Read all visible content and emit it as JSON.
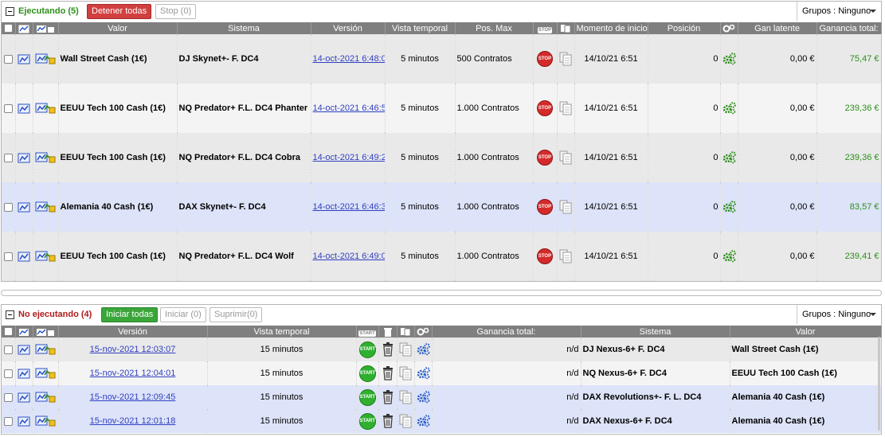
{
  "executing": {
    "title": "Ejecutando (5)",
    "stop_all_label": "Detener todas",
    "stop_label": "Stop (0)",
    "groups_label": "Grupos : Ninguno",
    "columns": {
      "valor": "Valor",
      "sistema": "Sistema",
      "version": "Versión",
      "vista": "Vista temporal",
      "posmax": "Pos. Max",
      "stop": "STOP",
      "inicio": "Momento de inicio",
      "posicion": "Posición",
      "latente": "Gan latente",
      "ganancia": "Ganancia total:"
    },
    "rows": [
      {
        "valor": "Wall Street Cash (1€)",
        "sistema": "DJ Skynet+-  F. DC4",
        "version": "14-oct-2021 6:48:0",
        "vista": "5 minutos",
        "posmax": "500 Contratos",
        "stop": "STOP",
        "inicio": "14/10/21 6:51",
        "posicion": "0",
        "latente": "0,00 €",
        "ganancia": "75,47 €",
        "style": "row-gray"
      },
      {
        "valor": "EEUU Tech 100 Cash (1€)",
        "sistema": "NQ Predator+ F.L. DC4 Phanter",
        "version": "14-oct-2021 6:46:5",
        "vista": "5 minutos",
        "posmax": "1.000 Contratos",
        "stop": "STOP",
        "inicio": "14/10/21 6:51",
        "posicion": "0",
        "latente": "0,00 €",
        "ganancia": "239,36 €",
        "style": "row-white"
      },
      {
        "valor": "EEUU Tech 100 Cash (1€)",
        "sistema": "NQ Predator+ F.L. DC4 Cobra",
        "version": "14-oct-2021 6:49:2",
        "vista": "5 minutos",
        "posmax": "1.000 Contratos",
        "stop": "STOP",
        "inicio": "14/10/21 6:51",
        "posicion": "0",
        "latente": "0,00 €",
        "ganancia": "239,36 €",
        "style": "row-gray"
      },
      {
        "valor": "Alemania 40 Cash (1€)",
        "sistema": "DAX Skynet+-  F. DC4",
        "version": "14-oct-2021 6:46:3",
        "vista": "5 minutos",
        "posmax": "1.000 Contratos",
        "stop": "STOP",
        "inicio": "14/10/21 6:51",
        "posicion": "0",
        "latente": "0,00 €",
        "ganancia": "83,57 €",
        "style": "row-blue"
      },
      {
        "valor": "EEUU Tech 100 Cash (1€)",
        "sistema": "NQ Predator+ F.L. DC4 Wolf",
        "version": "14-oct-2021 6:49:0",
        "vista": "5 minutos",
        "posmax": "1.000 Contratos",
        "stop": "STOP",
        "inicio": "14/10/21 6:51",
        "posicion": "0",
        "latente": "0,00 €",
        "ganancia": "239,41 €",
        "style": "row-gray"
      }
    ]
  },
  "not_executing": {
    "title": "No ejecutando (4)",
    "start_all_label": "Iniciar todas",
    "start_label": "Iniciar (0)",
    "delete_label": "Suprimir(0)",
    "groups_label": "Grupos : Ninguno",
    "columns": {
      "version": "Versión",
      "vista": "Vista temporal",
      "start": "START",
      "ganancia": "Ganancia total:",
      "sistema": "Sistema",
      "valor": "Valor"
    },
    "rows": [
      {
        "version": "15-nov-2021 12:03:07",
        "vista": "15 minutos",
        "start": "START",
        "ganancia": "n/d",
        "sistema": "DJ Nexus-6+ F. DC4",
        "valor": "Wall Street Cash (1€)",
        "style": "row-gray"
      },
      {
        "version": "15-nov-2021 12:04:01",
        "vista": "15 minutos",
        "start": "START",
        "ganancia": "n/d",
        "sistema": "NQ Nexus-6+ F. DC4",
        "valor": "EEUU Tech 100 Cash (1€)",
        "style": "row-white"
      },
      {
        "version": "15-nov-2021 12:09:45",
        "vista": "15 minutos",
        "start": "START",
        "ganancia": "n/d",
        "sistema": "DAX Revolutions+- F. L. DC4",
        "valor": "Alemania 40 Cash (1€)",
        "style": "row-blue"
      },
      {
        "version": "15-nov-2021 12:01:18",
        "vista": "15 minutos",
        "start": "START",
        "ganancia": "n/d",
        "sistema": "DAX Nexus-6+ F. DC4",
        "valor": "Alemania 40 Cash (1€)",
        "style": "row-blue"
      }
    ]
  }
}
